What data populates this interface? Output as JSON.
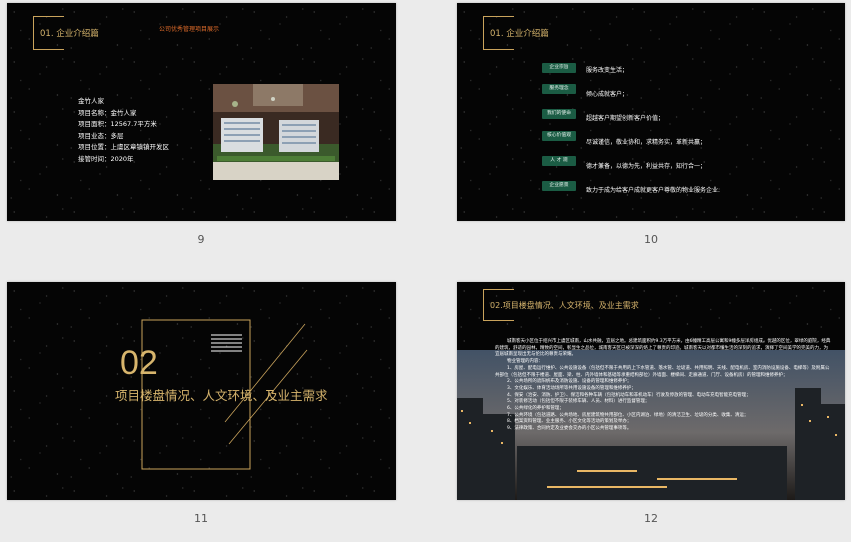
{
  "slides": [
    {
      "number": "9",
      "section_title": "01. 企业介绍篇",
      "top_label": "公司优秀管理项目展示",
      "info_lines": [
        "金竹人家",
        "项目名称：金竹人家",
        "项目面积：12567.7平方米",
        "项目业态：多层",
        "项目位置：上虞区章镇镇开发区",
        "接管时间：2020年"
      ]
    },
    {
      "number": "10",
      "section_title": "01. 企业介绍篇",
      "items": [
        {
          "badge": "企业宗旨",
          "text": "服务改变生活；"
        },
        {
          "badge": "服务理念",
          "text": "倾心成就客户；"
        },
        {
          "badge": "我们的使命",
          "text": "超越客户期望创新客户价值；"
        },
        {
          "badge": "核心价值观",
          "text": "尽诚谨信，敬业协和，求精务实，革新共赢；"
        },
        {
          "badge": "人 才 观",
          "text": "德才兼备，以德为先，利益共存，知行合一；"
        },
        {
          "badge": "企业愿景",
          "text": "致力于成为给客户成就更客户尊敬的物业服务企业."
        }
      ]
    },
    {
      "number": "11",
      "big_number": "02",
      "title": "项目楼盘情况、人文环境、及业主需求"
    },
    {
      "number": "12",
      "section_title": "02.项目楼盘情况、人文环境、及业主需求",
      "paragraphs": [
        "城南客天小区位于绍兴市上虞区城南，山水共融，宜居之地。总建筑面积约9.3万平方米，由6幢精工高层公寓和9幢多层洋房组成。优越的区位，翠绿的庭院，经典的建筑，舒适的园林，精致的空间，彰显生之品位，城南客天区已被深深的烙上了尊贵的印迹。城南客天以对都市懂生活的深刻的追求，演绎了空间美学的完美的力，为宜居城南呈现出无与伦比的尊贵与荣耀。",
        "物业管理的内容：",
        "1、房屋、配电运行维护、公共设施设备（包括但不限于共用的上下水管道、落水管、垃圾道、共用照明、天线、配电机房、室内消防设施设备、电梯等）及附属公共部位（包括但不限于楼道、屋面、梁、柱、内外墙体和基础等承重结构部位）外墙面、楼梯间、走廊通道、门厅、设备机房）的管理和维修养护；",
        "2、公共场所的遮阳帆布及消防设施、设备的管理和维修养护；",
        "3、文化娱乐、体育活动场所等共用设施设备的管理和维修养护；",
        "4、保安（治安、消防、护卫）、保洁和各种车辆（包括机动车和非机动车）行驶及停放的管理、电动车充电智能充电管理；",
        "5、对装修活动（包括但不限于装修车辆、人员、材料）进行监督管理；",
        "6、公共绿化的养护和管理；",
        "7、公共环境（包括道路、公共场地、房屋建筑物共用部位、小区内湖泊、绿地）的清洁卫生、垃圾的分类、收集、清运；",
        "8、档案资料管理、业主服务、小区文化等活动的策划及举办；",
        "9、法律政策、合同约定及业委会交办的小区公共管理事项等。"
      ]
    }
  ]
}
